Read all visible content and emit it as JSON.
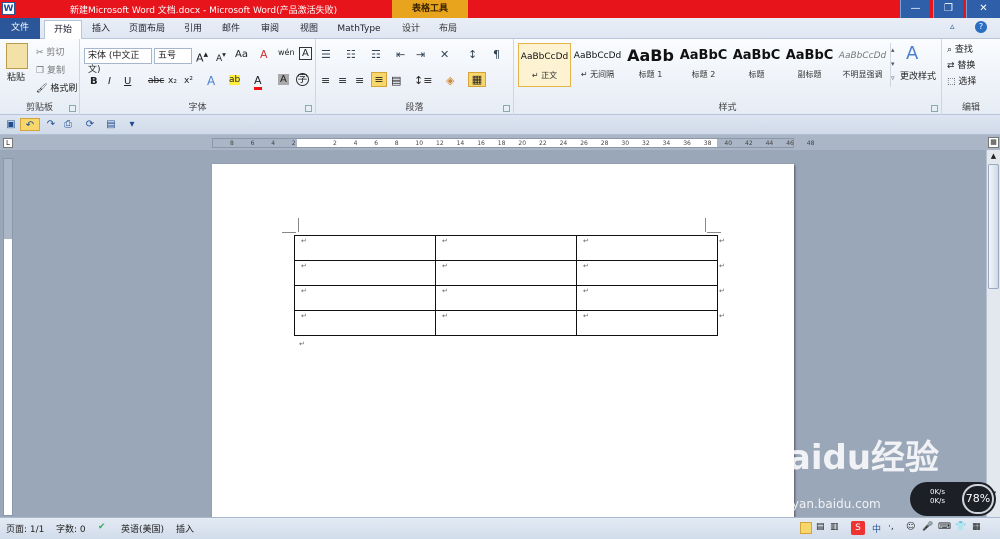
{
  "window": {
    "title": "新建Microsoft Word 文档.docx - Microsoft Word(产品激活失败)",
    "context_tab_header": "表格工具",
    "logo": "W",
    "min_icon": "minimize-icon",
    "max_icon": "restore-icon",
    "close_icon": "close-icon",
    "min_glyph": "—",
    "max_glyph": "❐",
    "close_glyph": "✕"
  },
  "tabs": [
    "文件",
    "开始",
    "插入",
    "页面布局",
    "引用",
    "邮件",
    "审阅",
    "视图",
    "MathType",
    "设计",
    "布局"
  ],
  "ribbon": {
    "clipboard": {
      "label": "剪贴板",
      "paste": "粘贴",
      "cut": "剪切",
      "copy": "复制",
      "format_painter": "格式刷"
    },
    "font": {
      "label": "字体",
      "font_name": "宋体 (中文正文)",
      "font_size": "五号",
      "grow": "A",
      "shrink": "A",
      "case": "Aa",
      "clear": "A",
      "pinyin": "wén",
      "border": "A",
      "bold": "B",
      "italic": "I",
      "underline": "U",
      "strike": "abc",
      "sub": "x₂",
      "sup": "x²",
      "effects": "A",
      "highlight": "ab",
      "color": "A",
      "shading": "A",
      "enclose": "字"
    },
    "paragraph": {
      "label": "段落"
    },
    "styles": {
      "label": "样式",
      "items": [
        {
          "sample": "AaBbCcDd",
          "name": "↵ 正文"
        },
        {
          "sample": "AaBbCcDd",
          "name": "↵ 无间隔"
        },
        {
          "sample": "AaBb",
          "name": "标题 1"
        },
        {
          "sample": "AaBbC",
          "name": "标题 2"
        },
        {
          "sample": "AaBbC",
          "name": "标题"
        },
        {
          "sample": "AaBbC",
          "name": "副标题"
        },
        {
          "sample": "AaBbCcDd",
          "name": "不明显强调"
        }
      ],
      "change_styles": "更改样式"
    },
    "editing": {
      "label": "编辑",
      "find": "查找",
      "replace": "替换",
      "select": "选择"
    }
  },
  "ruler": {
    "ticks": [
      "8",
      "6",
      "4",
      "2",
      "",
      "2",
      "4",
      "6",
      "8",
      "10",
      "12",
      "14",
      "16",
      "18",
      "20",
      "22",
      "24",
      "26",
      "28",
      "30",
      "32",
      "34",
      "36",
      "38",
      "40",
      "42",
      "44",
      "46",
      "48"
    ]
  },
  "document": {
    "para_mark": "↵",
    "rows": 4,
    "cols": 3
  },
  "status": {
    "page": "页面: 1/1",
    "words": "字数: 0",
    "language": "英语(美国)",
    "mode": "插入"
  },
  "watermark": {
    "text": "Baidu经验",
    "url": "jingyan.baidu.com"
  },
  "net_widget": {
    "percent": "78%",
    "speed_up": "0K/s",
    "speed_down": "0K/s"
  }
}
